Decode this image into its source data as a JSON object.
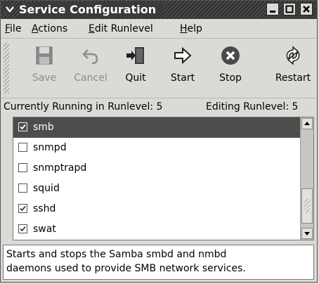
{
  "window": {
    "title": "Service Configuration"
  },
  "menubar": {
    "items": [
      {
        "label": "File",
        "mnemonic": "F",
        "rest": "ile"
      },
      {
        "label": "Actions",
        "mnemonic": "A",
        "rest": "ctions"
      },
      {
        "label": "Edit Runlevel",
        "mnemonic": "E",
        "rest": "dit Runlevel"
      },
      {
        "label": "Help",
        "mnemonic": "H",
        "rest": "elp"
      }
    ]
  },
  "toolbar": {
    "save_label": "Save",
    "cancel_label": "Cancel",
    "quit_label": "Quit",
    "start_label": "Start",
    "stop_label": "Stop",
    "restart_label": "Restart"
  },
  "status": {
    "running": "Currently Running in Runlevel: 5",
    "editing": "Editing Runlevel: 5"
  },
  "services": [
    {
      "name": "smb",
      "checked": true,
      "selected": true
    },
    {
      "name": "snmpd",
      "checked": false,
      "selected": false
    },
    {
      "name": "snmptrapd",
      "checked": false,
      "selected": false
    },
    {
      "name": "squid",
      "checked": false,
      "selected": false
    },
    {
      "name": "sshd",
      "checked": true,
      "selected": false
    },
    {
      "name": "swat",
      "checked": true,
      "selected": false
    }
  ],
  "description": {
    "line1": "Starts and stops the Samba smbd and nmbd",
    "line2": "daemons used to provide SMB network services."
  },
  "colors": {
    "selection": "#4d4d4d",
    "titlebar": "#3a3a3a",
    "stop_icon": "#4a4a4a"
  }
}
